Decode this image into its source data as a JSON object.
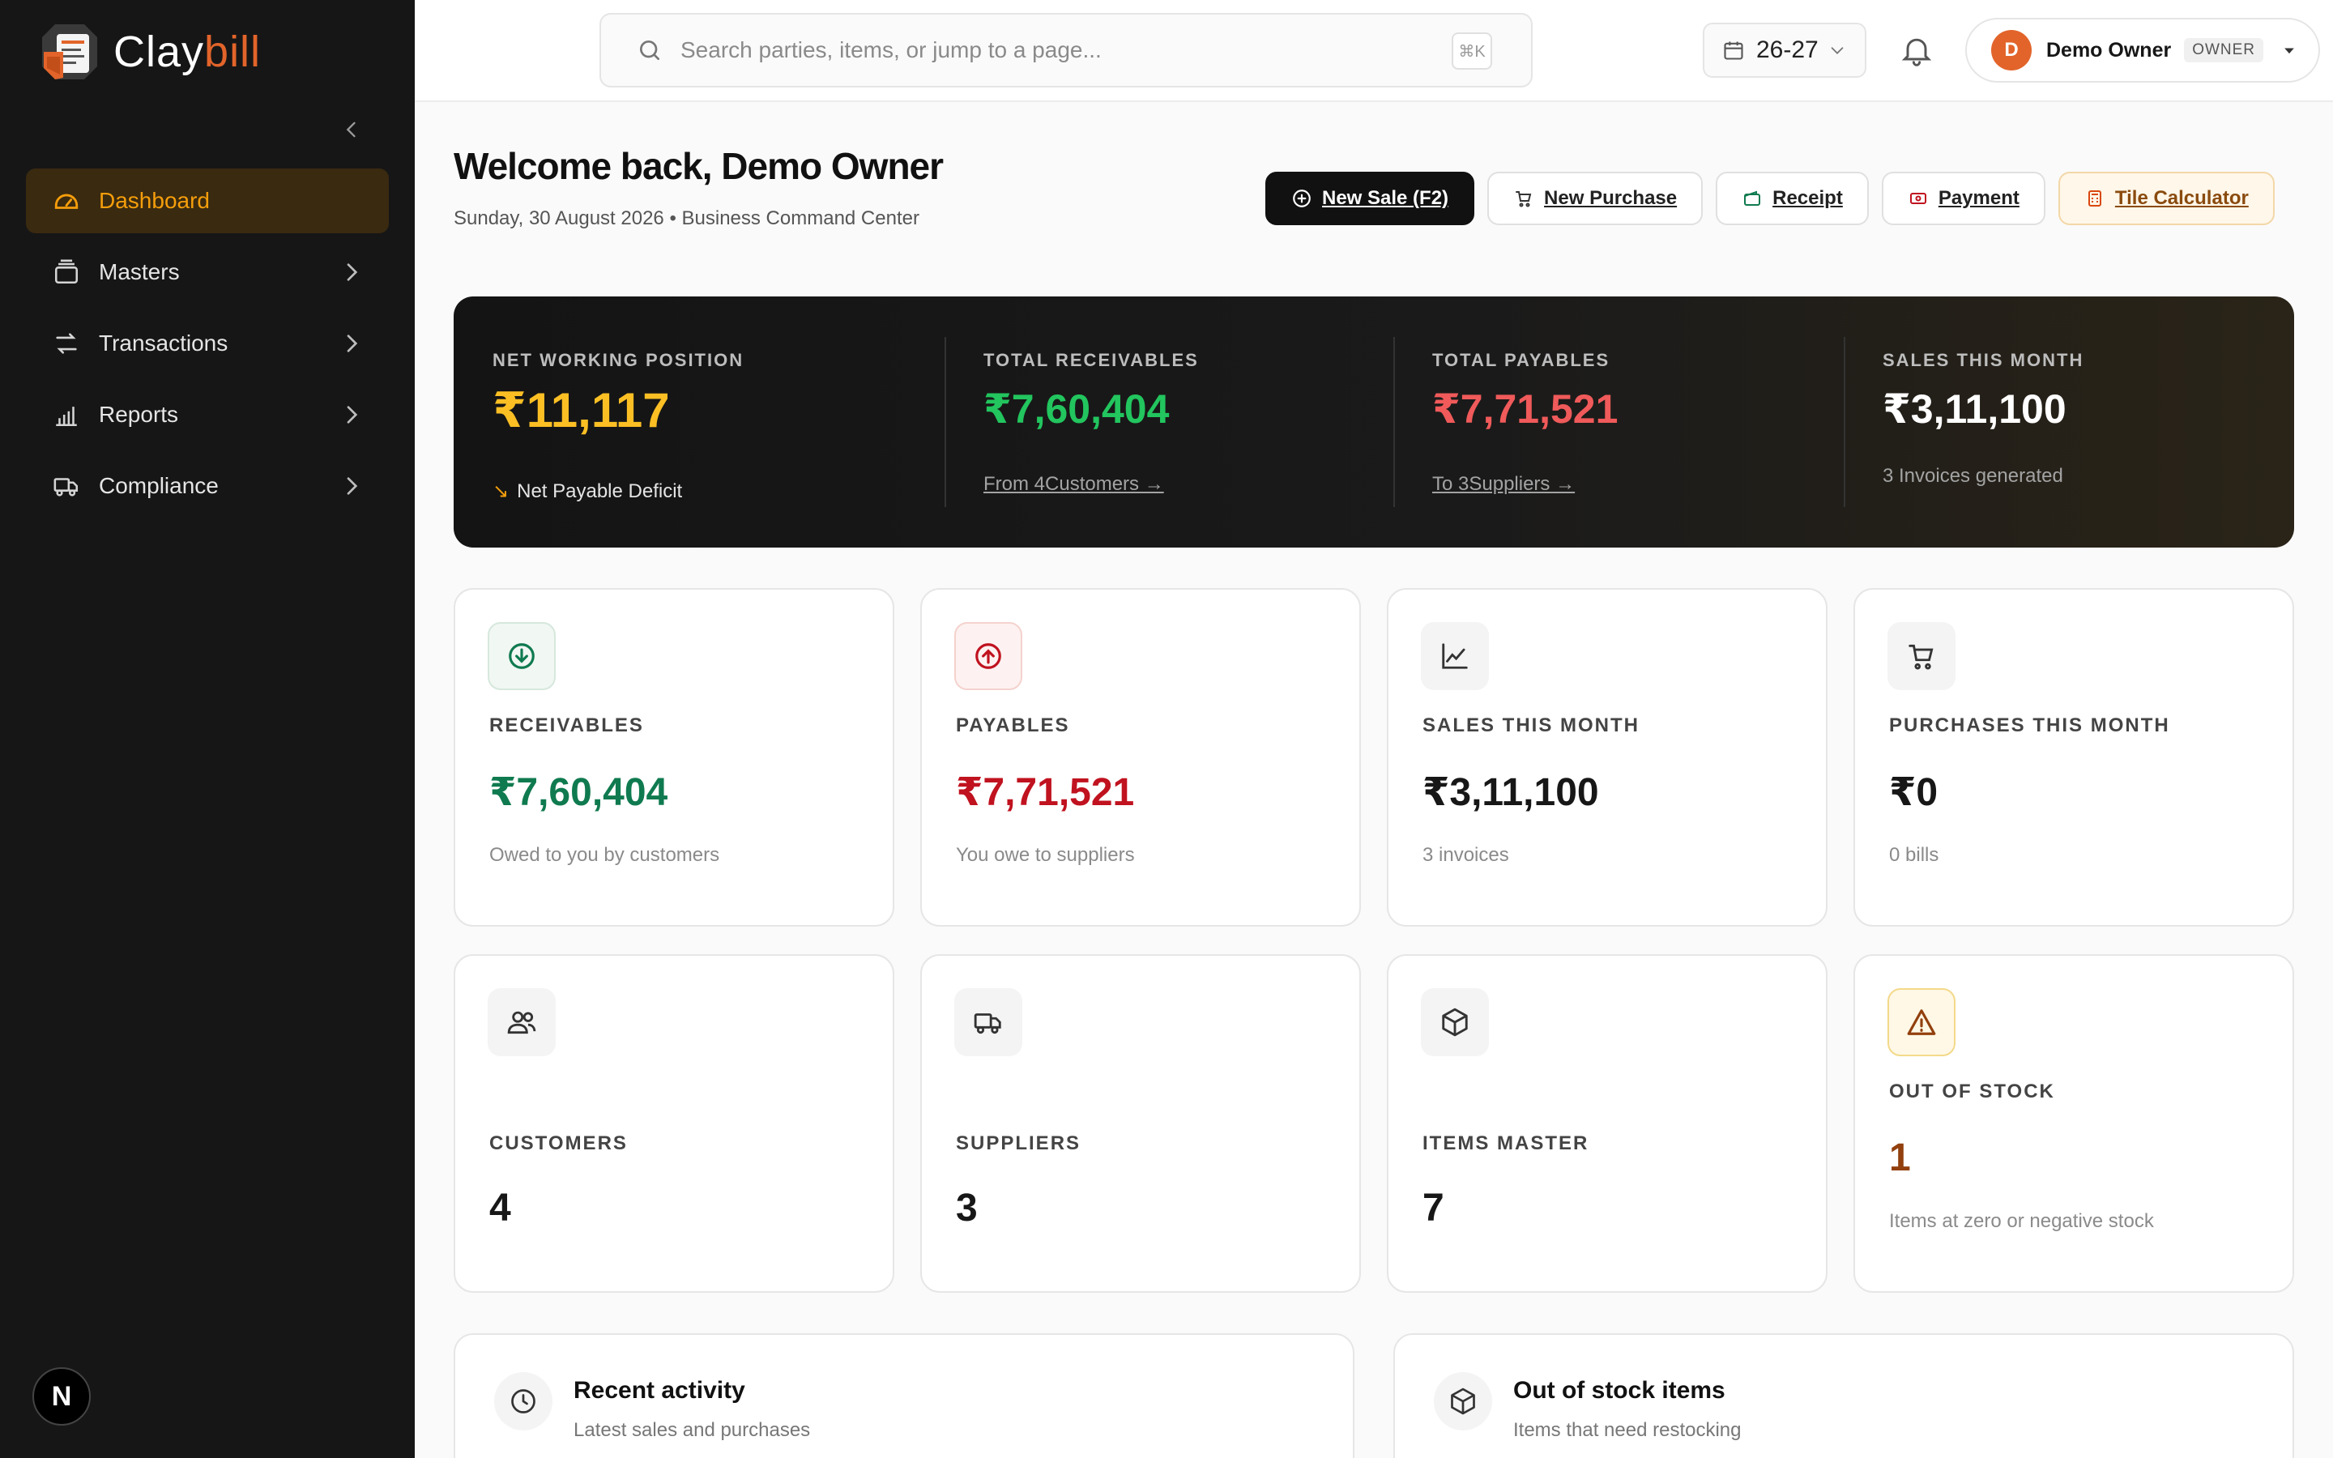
{
  "brand": {
    "name_main": "Clay",
    "name_accent": "bill"
  },
  "sidebar": {
    "items": [
      {
        "label": "Dashboard",
        "icon": "gauge-icon",
        "active": true
      },
      {
        "label": "Masters",
        "icon": "stack-icon"
      },
      {
        "label": "Transactions",
        "icon": "swap-icon"
      },
      {
        "label": "Reports",
        "icon": "bar-chart-icon"
      },
      {
        "label": "Compliance",
        "icon": "truck-icon"
      }
    ],
    "footer_badge": "N"
  },
  "topbar": {
    "search_placeholder": "Search parties, items, or jump to a page...",
    "search_shortcut": "⌘K",
    "fiscal_year": "26-27",
    "user": {
      "initial": "D",
      "name": "Demo Owner",
      "role": "OWNER"
    }
  },
  "header": {
    "title": "Welcome back, Demo Owner",
    "subtitle": "Sunday, 30 August 2026 • Business Command Center"
  },
  "actions": {
    "new_sale": "New Sale (F2)",
    "new_purchase": "New Purchase",
    "receipt": "Receipt",
    "payment": "Payment",
    "tile_calculator": "Tile Calculator"
  },
  "hero": {
    "net": {
      "label": "NET WORKING POSITION",
      "value": "₹11,117",
      "sub": "Net Payable Deficit",
      "arrow": "↘"
    },
    "receivables": {
      "label": "TOTAL RECEIVABLES",
      "value": "₹7,60,404",
      "link": "From 4Customers →"
    },
    "payables": {
      "label": "TOTAL PAYABLES",
      "value": "₹7,71,521",
      "link": "To 3Suppliers →"
    },
    "sales": {
      "label": "SALES THIS MONTH",
      "value": "₹3,11,100",
      "sub": "3 Invoices generated"
    }
  },
  "cards": {
    "receivables": {
      "label": "RECEIVABLES",
      "value": "₹7,60,404",
      "sub": "Owed to you by customers"
    },
    "payables": {
      "label": "PAYABLES",
      "value": "₹7,71,521",
      "sub": "You owe to suppliers"
    },
    "sales": {
      "label": "SALES THIS MONTH",
      "value": "₹3,11,100",
      "sub": "3 invoices"
    },
    "purchases": {
      "label": "PURCHASES THIS MONTH",
      "value": "₹0",
      "sub": "0 bills"
    },
    "customers": {
      "label": "CUSTOMERS",
      "value": "4"
    },
    "suppliers": {
      "label": "SUPPLIERS",
      "value": "3"
    },
    "items": {
      "label": "ITEMS MASTER",
      "value": "7"
    },
    "out_of_stock": {
      "label": "OUT OF STOCK",
      "value": "1",
      "sub": "Items at zero or negative stock"
    }
  },
  "panels": {
    "recent": {
      "title": "Recent activity",
      "sub": "Latest sales and purchases"
    },
    "stock": {
      "title": "Out of stock items",
      "sub": "Items that need restocking"
    }
  },
  "colors": {
    "accent": "#f59e0b",
    "brand": "#e2642a",
    "positive": "#0f7a4f",
    "negative": "#c0121f",
    "hero_positive": "#22c55e",
    "hero_negative": "#f05a5a",
    "stock_warning": "#92400e"
  }
}
